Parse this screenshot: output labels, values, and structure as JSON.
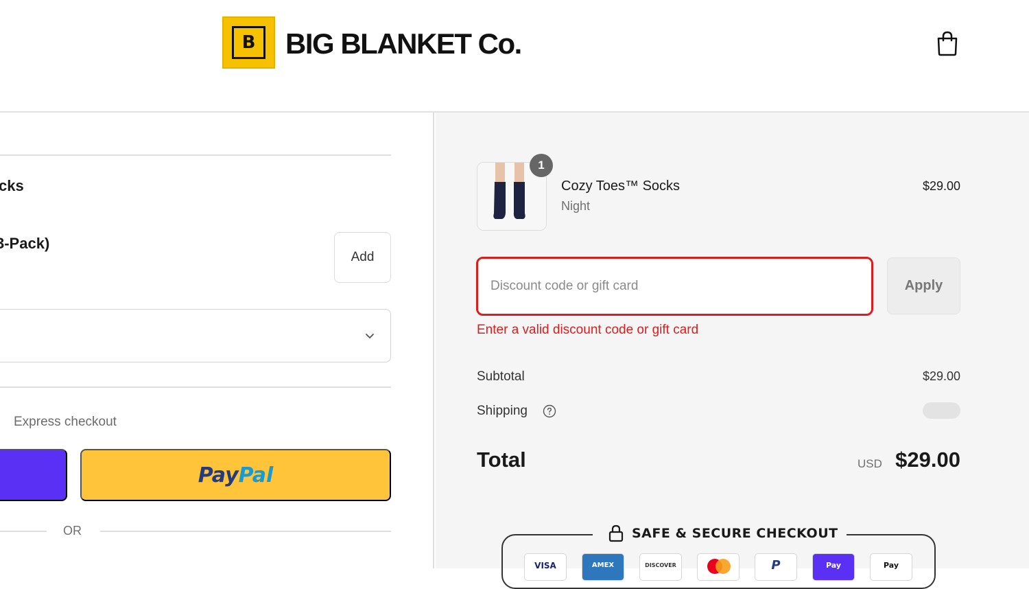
{
  "header": {
    "logo_glyph": "B",
    "brand_name": "BIG BLANKET Co."
  },
  "left": {
    "upsell": {
      "title": "cks",
      "variant": "3-Pack)",
      "add_label": "Add"
    },
    "express_checkout_label": "Express checkout",
    "paypal": {
      "part1": "Pay",
      "part2": "Pal"
    },
    "or_label": "OR"
  },
  "cart": {
    "item": {
      "quantity": "1",
      "name": "Cozy Toes™ Socks",
      "variant": "Night",
      "price": "$29.00"
    },
    "discount": {
      "placeholder": "Discount code or gift card",
      "value": "",
      "apply_label": "Apply",
      "error": "Enter a valid discount code or gift card"
    },
    "subtotal_label": "Subtotal",
    "subtotal_value": "$29.00",
    "shipping_label": "Shipping",
    "total_label": "Total",
    "currency": "USD",
    "total_value": "$29.00"
  },
  "secure": {
    "label": "SAFE & SECURE CHECKOUT",
    "payment_icons": [
      "visa-icon",
      "amex-icon",
      "discover-icon",
      "mastercard-icon",
      "paypal-icon",
      "shop-pay-icon",
      "apple-pay-icon"
    ]
  },
  "colors": {
    "error": "#dd1d1d",
    "paypal_yellow": "#ffc439",
    "shop_pay_purple": "#5a31f4",
    "brand_yellow": "#f6c200"
  }
}
